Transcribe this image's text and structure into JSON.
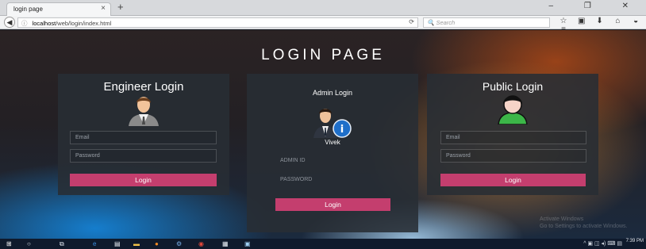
{
  "browser": {
    "tab_title": "login page",
    "tab_close": "×",
    "new_tab": "+",
    "window_controls": "–  ❐  ✕",
    "url_host": "localhost",
    "url_path": "/web/login/index.html",
    "reload": "⟳",
    "search_placeholder": "Search",
    "search_icon": "🔍",
    "toolbar_icons": [
      "star-icon",
      "clipboard-icon",
      "download-icon",
      "home-icon",
      "pocket-icon",
      "menu-icon"
    ]
  },
  "page": {
    "title": "LOGIN PAGE"
  },
  "engineer": {
    "title": "Engineer Login",
    "email_placeholder": "Email",
    "password_placeholder": "Password",
    "button": "Login"
  },
  "admin": {
    "title": "Admin Login",
    "name": "Vivek",
    "id_placeholder": "ADMIN ID",
    "password_placeholder": "PASSWORD",
    "button": "Login"
  },
  "public": {
    "title": "Public Login",
    "email_placeholder": "Email",
    "password_placeholder": "Password",
    "button": "Login"
  },
  "watermark": {
    "line1": "Activate Windows",
    "line2": "Go to Settings to activate Windows."
  },
  "taskbar": {
    "clock": "7:39 PM",
    "tray": "^ ▣ ◫ ◂) ⌨ ▤"
  },
  "colors": {
    "accent": "#c43e6e",
    "panel": "#2c3138",
    "taskbar": "#0f1a2c"
  }
}
